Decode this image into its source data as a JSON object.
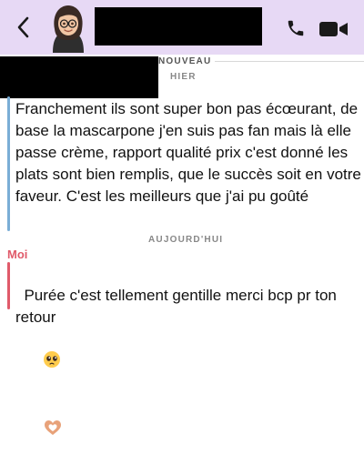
{
  "header": {
    "back_icon": "chevron-left-icon",
    "call_icon": "phone-icon",
    "video_icon": "video-camera-icon",
    "background": "#e7d9f5",
    "accent": "#7b3fa8"
  },
  "dividers": {
    "new_label": "NOUVEAU",
    "yesterday_label": "HIER",
    "today_label": "AUJOURD'HUI"
  },
  "messages": [
    {
      "sender": "",
      "bar_color": "#7aaed6",
      "text": "Franchement ils sont super bon pas écœurant, de base la mascarpone j'en suis pas fan mais là elle passe crème, rapport qualité prix c'est donné les plats sont bien remplis, que le succès soit en votre faveur. C'est les meilleurs que j'ai pu goûté"
    },
    {
      "sender": "Moi",
      "sender_color": "#e05a6a",
      "bar_color": "#e05a6a",
      "text": "Purée c'est tellement gentille merci bcp pr ton retour",
      "emojis": [
        "pleading-face-emoji",
        "heart-hands-emoji"
      ]
    }
  ]
}
